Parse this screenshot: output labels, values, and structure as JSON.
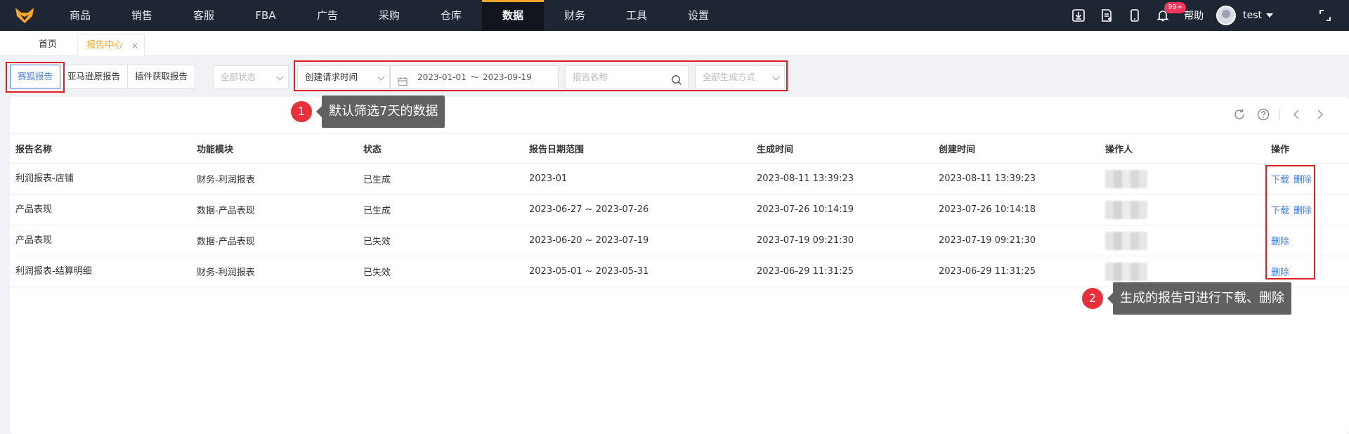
{
  "topnav": {
    "items": [
      "商品",
      "销售",
      "客服",
      "FBA",
      "广告",
      "采购",
      "仓库",
      "数据",
      "财务",
      "工具",
      "设置"
    ],
    "active": "数据",
    "notification_badge": "99+",
    "help_label": "帮助",
    "username": "test"
  },
  "tabs": {
    "home": "首页",
    "report": "报告中心",
    "close": "×"
  },
  "filters": {
    "segments": [
      "赛狐报告",
      "亚马逊原报告",
      "插件获取报告"
    ],
    "status_placeholder": "全部状态",
    "date_type": "创建请求时间",
    "date_start": "2023-01-01",
    "date_sep": "～",
    "date_end": "2023-09-19",
    "name_placeholder": "报告名称",
    "method_placeholder": "全部生成方式"
  },
  "table": {
    "headers": [
      "报告名称",
      "功能模块",
      "状态",
      "报告日期范围",
      "生成时间",
      "创建时间",
      "操作人",
      "操作"
    ],
    "rows": [
      {
        "name": "利润报表-店铺",
        "module": "财务-利润报表",
        "status": "已生成",
        "range": "2023-01",
        "generated": "2023-08-11 13:39:23",
        "created": "2023-08-11 13:39:23",
        "actions": [
          "下载",
          "删除"
        ]
      },
      {
        "name": "产品表现",
        "module": "数据-产品表现",
        "status": "已生成",
        "range": "2023-06-27 ~ 2023-07-26",
        "generated": "2023-07-26 10:14:19",
        "created": "2023-07-26 10:14:18",
        "actions": [
          "下载",
          "删除"
        ]
      },
      {
        "name": "产品表现",
        "module": "数据-产品表现",
        "status": "已失效",
        "range": "2023-06-20 ~ 2023-07-19",
        "generated": "2023-07-19 09:21:30",
        "created": "2023-07-19 09:21:30",
        "actions": [
          "删除"
        ]
      },
      {
        "name": "利润报表-结算明细",
        "module": "财务-利润报表",
        "status": "已失效",
        "range": "2023-05-01 ~ 2023-05-31",
        "generated": "2023-06-29 11:31:25",
        "created": "2023-06-29 11:31:25",
        "actions": [
          "删除"
        ]
      }
    ]
  },
  "callouts": [
    {
      "num": "1",
      "text": "默认筛选7天的数据"
    },
    {
      "num": "2",
      "text": "生成的报告可进行下载、删除"
    }
  ],
  "colors": {
    "accent": "#4a7ee8",
    "nav_bg": "#1f2633",
    "highlight": "#e02020",
    "active_tab": "#f5a623"
  },
  "icons": [
    "logo-fox",
    "download-icon",
    "export-doc-icon",
    "mobile-icon",
    "bell-icon",
    "fullscreen-icon",
    "calendar-icon",
    "search-icon",
    "refresh-icon",
    "help-icon",
    "prev-icon",
    "next-icon"
  ]
}
